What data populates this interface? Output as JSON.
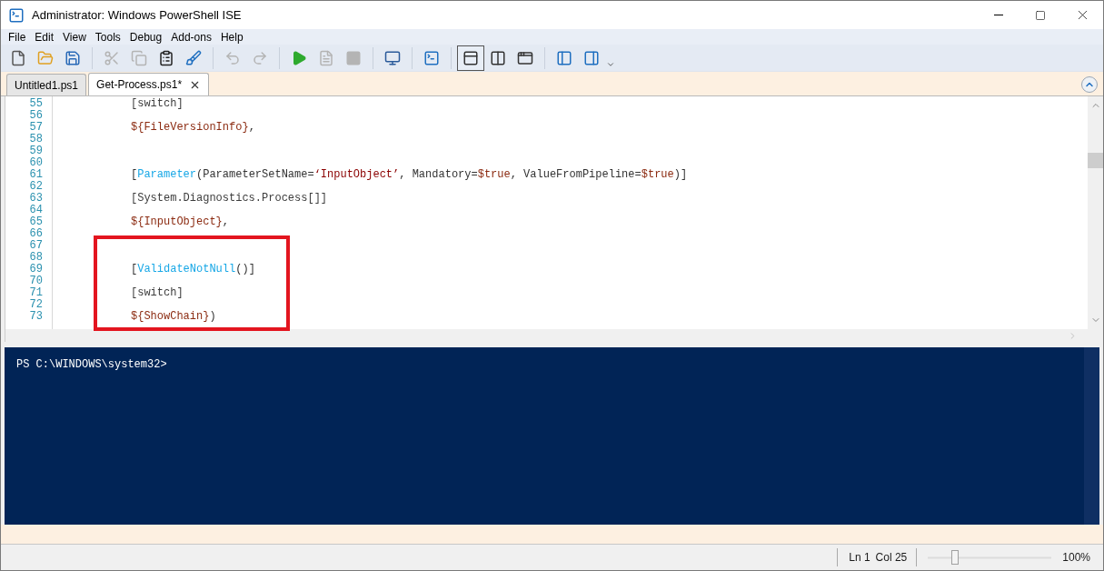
{
  "window": {
    "title": "Administrator: Windows PowerShell ISE"
  },
  "menu": [
    "File",
    "Edit",
    "View",
    "Tools",
    "Debug",
    "Add-ons",
    "Help"
  ],
  "toolbar": [
    {
      "kind": "new",
      "disabled": false
    },
    {
      "kind": "open",
      "disabled": false
    },
    {
      "kind": "save",
      "disabled": false
    },
    {
      "kind": "sep"
    },
    {
      "kind": "cut",
      "disabled": true
    },
    {
      "kind": "copy",
      "disabled": true
    },
    {
      "kind": "paste",
      "disabled": false
    },
    {
      "kind": "clear",
      "disabled": false
    },
    {
      "kind": "sep"
    },
    {
      "kind": "undo",
      "disabled": true
    },
    {
      "kind": "redo",
      "disabled": true
    },
    {
      "kind": "sep"
    },
    {
      "kind": "run",
      "disabled": false
    },
    {
      "kind": "runsel",
      "disabled": true
    },
    {
      "kind": "stop",
      "disabled": true
    },
    {
      "kind": "sep"
    },
    {
      "kind": "remote",
      "disabled": false
    },
    {
      "kind": "sep"
    },
    {
      "kind": "console",
      "disabled": false
    },
    {
      "kind": "sep"
    },
    {
      "kind": "layout-top",
      "disabled": false,
      "selected": true
    },
    {
      "kind": "layout-right",
      "disabled": false,
      "selected": false
    },
    {
      "kind": "layout-max",
      "disabled": false,
      "selected": false
    },
    {
      "kind": "sep"
    },
    {
      "kind": "cmd-window",
      "disabled": false
    },
    {
      "kind": "cmd-addon",
      "disabled": false
    },
    {
      "kind": "more"
    }
  ],
  "tabs": [
    {
      "label": "Untitled1.ps1",
      "selected": false
    },
    {
      "label": "Get-Process.ps1*",
      "selected": true
    }
  ],
  "editor": {
    "lines": [
      {
        "n": "55",
        "tokens": [
          {
            "kind": "type",
            "text": "[switch]"
          }
        ]
      },
      {
        "n": "56"
      },
      {
        "n": "57",
        "tokens": [
          {
            "kind": "variable",
            "text": "${FileVersionInfo}"
          },
          {
            "kind": "plain",
            "text": ","
          }
        ]
      },
      {
        "n": "58"
      },
      {
        "n": "59"
      },
      {
        "n": "60"
      },
      {
        "n": "61",
        "tokens": [
          {
            "kind": "plain",
            "text": "["
          },
          {
            "kind": "attribute",
            "text": "Parameter"
          },
          {
            "kind": "plain",
            "text": "(ParameterSetName="
          },
          {
            "kind": "string",
            "text": "‘InputObject’"
          },
          {
            "kind": "plain",
            "text": ", Mandatory="
          },
          {
            "kind": "variable",
            "text": "$true"
          },
          {
            "kind": "plain",
            "text": ", ValueFromPipeline="
          },
          {
            "kind": "variable",
            "text": "$true"
          },
          {
            "kind": "plain",
            "text": ")]"
          }
        ]
      },
      {
        "n": "62"
      },
      {
        "n": "63",
        "tokens": [
          {
            "kind": "type",
            "text": "[System.Diagnostics.Process[]]"
          }
        ]
      },
      {
        "n": "64"
      },
      {
        "n": "65",
        "tokens": [
          {
            "kind": "variable",
            "text": "${InputObject}"
          },
          {
            "kind": "plain",
            "text": ","
          }
        ]
      },
      {
        "n": "66"
      },
      {
        "n": "67",
        "highlight_start": true
      },
      {
        "n": "68"
      },
      {
        "n": "69",
        "tokens": [
          {
            "kind": "plain",
            "text": "["
          },
          {
            "kind": "attribute",
            "text": "ValidateNotNull"
          },
          {
            "kind": "plain",
            "text": "()]"
          }
        ]
      },
      {
        "n": "70"
      },
      {
        "n": "71",
        "tokens": [
          {
            "kind": "type",
            "text": "[switch]"
          }
        ]
      },
      {
        "n": "72"
      },
      {
        "n": "73",
        "tokens": [
          {
            "kind": "variable",
            "text": "${ShowChain}"
          },
          {
            "kind": "plain",
            "text": ")"
          }
        ]
      }
    ]
  },
  "console": {
    "prompt": "PS C:\\WINDOWS\\system32>"
  },
  "status_bar": {
    "line": "Ln 1",
    "column": "Col 25",
    "zoom": {
      "level": 0.22
    },
    "zoom_label": "100%"
  }
}
